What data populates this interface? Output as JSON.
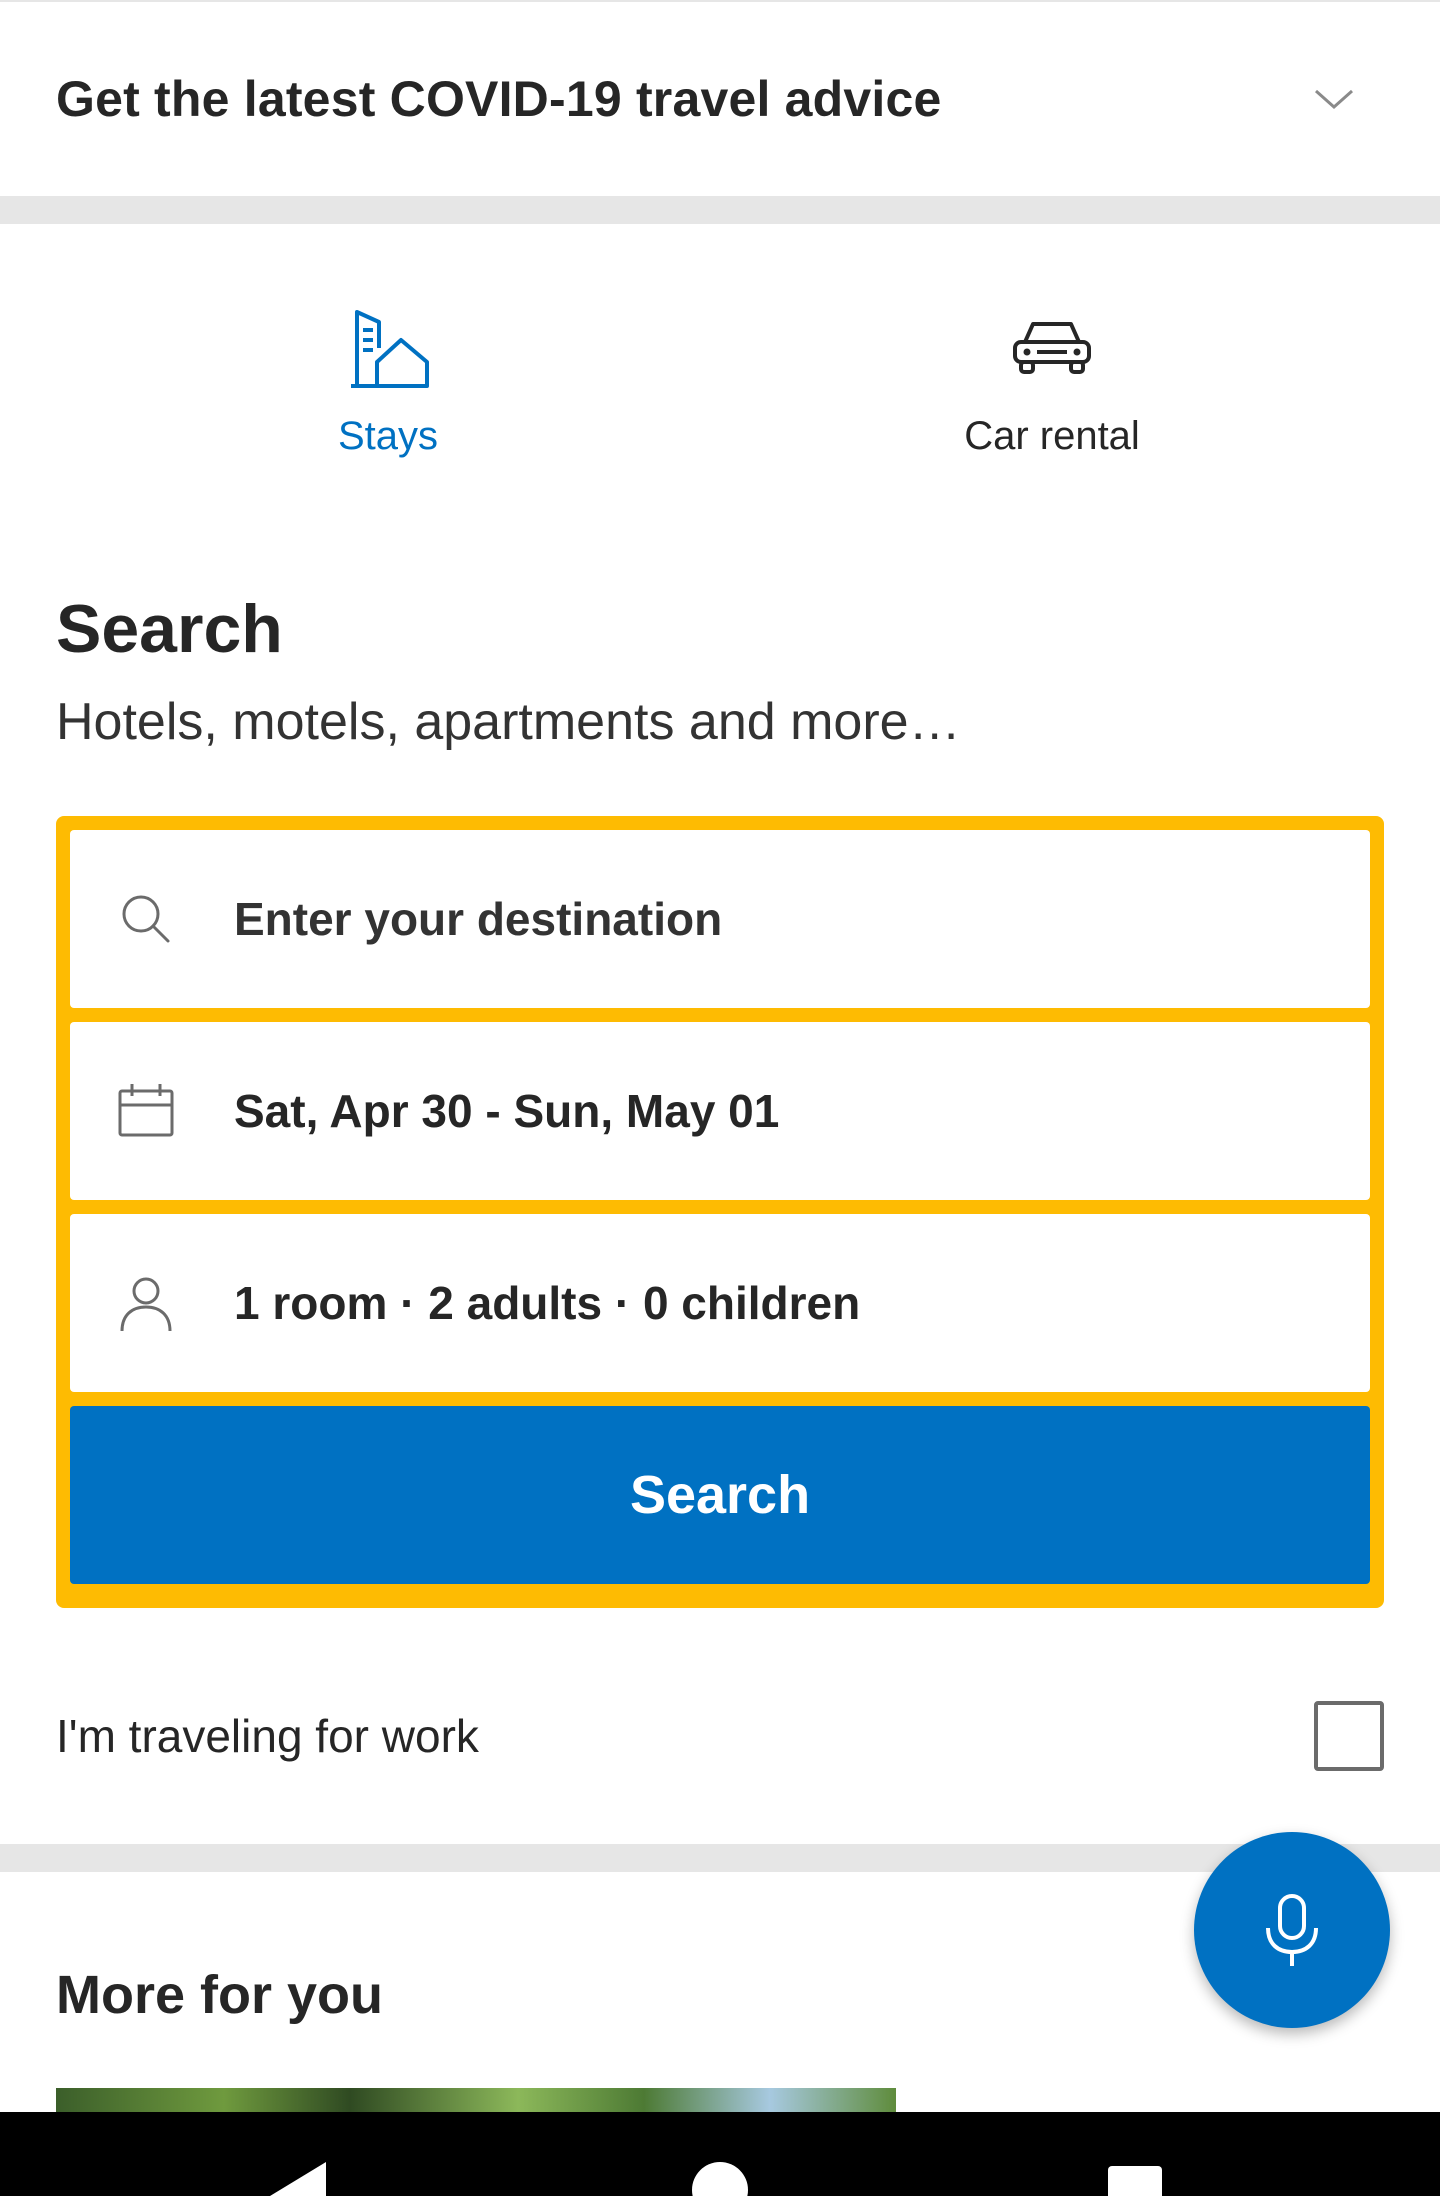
{
  "covid_banner": {
    "text": "Get the latest COVID-19 travel advice",
    "icon": "chevron-down-icon"
  },
  "tabs": [
    {
      "label": "Stays",
      "icon": "hotel-house-icon",
      "active": true
    },
    {
      "label": "Car rental",
      "icon": "car-icon",
      "active": false
    }
  ],
  "search": {
    "title": "Search",
    "subtitle": "Hotels, motels, apartments and more…",
    "destination_placeholder": "Enter your destination",
    "dates": "Sat, Apr 30 - Sun, May 01",
    "occupancy": "1 room · 2 adults · 0 children",
    "button_label": "Search"
  },
  "work_travel": {
    "label": "I'm traveling for work",
    "checked": false
  },
  "more_for_you": {
    "title": "More for you"
  },
  "colors": {
    "accent_blue": "#0071c2",
    "search_border_yellow": "#febb02",
    "divider_gray": "#e6e6e6"
  }
}
